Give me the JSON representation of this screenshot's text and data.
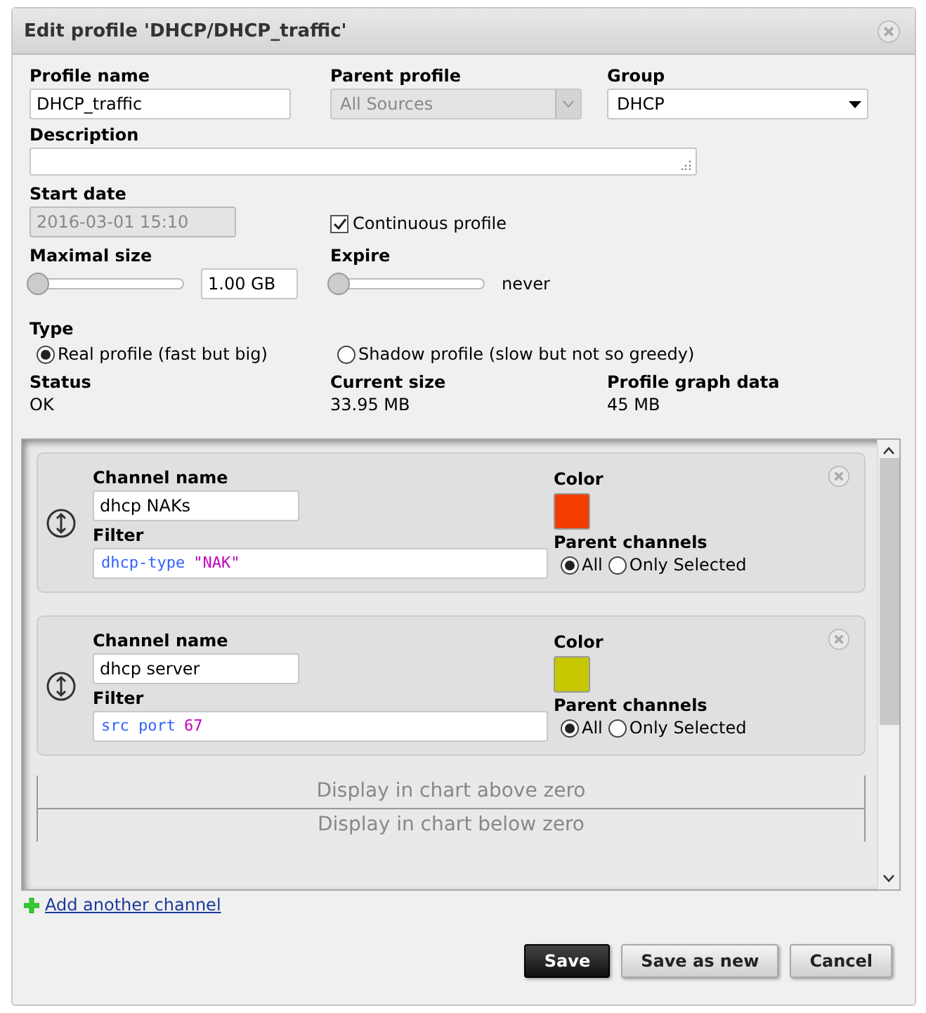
{
  "window": {
    "title": "Edit profile 'DHCP/DHCP_traffic'"
  },
  "profile_name": {
    "label": "Profile name",
    "value": "DHCP_traffic"
  },
  "parent_profile": {
    "label": "Parent profile",
    "value": "All Sources",
    "disabled": true
  },
  "group": {
    "label": "Group",
    "value": "DHCP"
  },
  "description": {
    "label": "Description"
  },
  "start_date": {
    "label": "Start date",
    "value": "2016-03-01 15:10",
    "disabled": true
  },
  "continuous": {
    "label": "Continuous profile",
    "checked": true
  },
  "maximal_size": {
    "label": "Maximal size",
    "level": 0,
    "value": "1.00 GB"
  },
  "expire": {
    "label": "Expire",
    "level": 0,
    "reading": "never"
  },
  "type": {
    "label": "Type",
    "options": [
      {
        "label": "Real profile (fast but big)",
        "selected": true
      },
      {
        "label": "Shadow profile (slow but not so greedy)",
        "selected": false
      }
    ]
  },
  "info": [
    {
      "label": "Status",
      "value": "OK"
    },
    {
      "label": "Current size",
      "value": "33.95 MB"
    },
    {
      "label": "Profile graph data",
      "value": "45 MB"
    }
  ],
  "channels": [
    {
      "name_label": "Channel name",
      "name": "dhcp NAKs",
      "color_label": "Color",
      "color": "#f23c00",
      "filter_label": "Filter",
      "filter": [
        {
          "kind": "keyword",
          "text": "dhcp-type"
        },
        {
          "kind": "value",
          "text": "\"NAK\""
        }
      ],
      "parent_label": "Parent channels",
      "parent_options": [
        {
          "label": "All",
          "selected": true
        },
        {
          "label": "Only Selected",
          "selected": false
        }
      ]
    },
    {
      "name_label": "Channel name",
      "name": "dhcp server",
      "color_label": "Color",
      "color": "#c8c800",
      "filter_label": "Filter",
      "filter": [
        {
          "kind": "keyword",
          "text": "src port"
        },
        {
          "kind": "value",
          "text": "67"
        }
      ],
      "parent_label": "Parent channels",
      "parent_options": [
        {
          "label": "All",
          "selected": true
        },
        {
          "label": "Only Selected",
          "selected": false
        }
      ]
    }
  ],
  "dividers": [
    "Display in chart above zero",
    "Display in chart below zero"
  ],
  "add_channel": "Add another channel",
  "buttons": [
    {
      "label": "Save",
      "kind": "primary"
    },
    {
      "label": "Save as new",
      "kind": "secondary"
    },
    {
      "label": "Cancel",
      "kind": "secondary"
    }
  ]
}
